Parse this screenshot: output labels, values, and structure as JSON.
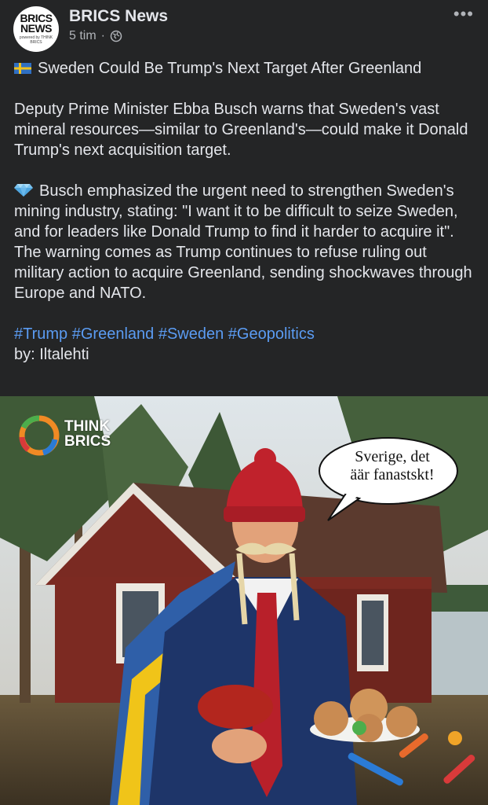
{
  "header": {
    "avatar_line1": "BRICS",
    "avatar_line2": "NEWS",
    "avatar_sub": "powered by THINK BRICS",
    "page_name": "BRICS News",
    "time": "5 tim",
    "separator": "·",
    "more": "•••"
  },
  "post": {
    "headline": "Sweden Could Be Trump's Next Target After Greenland",
    "paragraph1": "Deputy Prime Minister Ebba Busch warns that Sweden's vast mineral resources—similar to Greenland's—could make it Donald Trump's next acquisition target.",
    "paragraph2": "Busch emphasized the urgent need to strengthen Sweden's mining industry, stating: \"I want it to be difficult to seize Sweden, and for leaders like Donald Trump to find it harder to acquire it\". The warning comes as Trump continues to refuse ruling out military action to acquire Greenland, sending shockwaves through Europe and NATO.",
    "hashtags": [
      "#Trump",
      "#Greenland",
      "#Sweden",
      "#Geopolitics"
    ],
    "byline": "by: Iltalehti"
  },
  "image": {
    "watermark_line1": "THINK",
    "watermark_line2": "BRICS",
    "speech_line1": "Sverige, det",
    "speech_line2": "äär fanastskt!"
  },
  "colors": {
    "background": "#242526",
    "text": "#e4e6eb",
    "secondary_text": "#b0b3b8",
    "hashtag": "#5b9cf3"
  }
}
